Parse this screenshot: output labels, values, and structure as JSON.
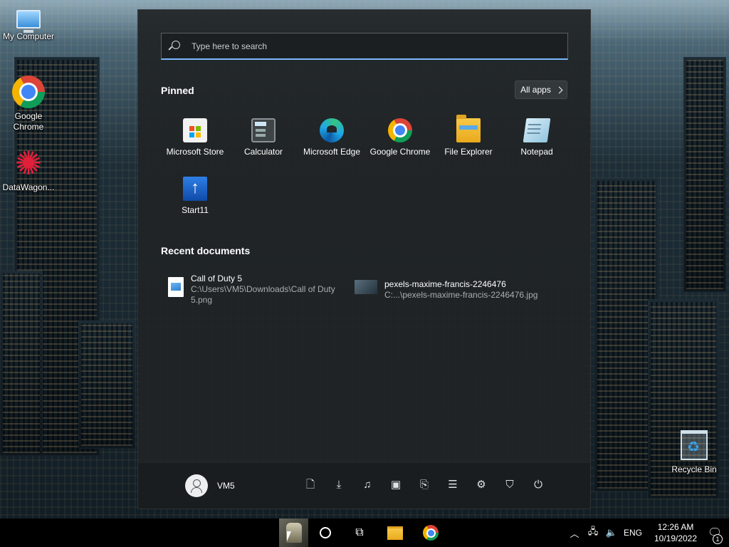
{
  "desktop": {
    "icons": [
      {
        "label": "My Computer"
      },
      {
        "label": "Google Chrome"
      },
      {
        "label": "DataWagon..."
      },
      {
        "label": "Recycle Bin"
      }
    ]
  },
  "start_menu": {
    "search": {
      "placeholder": "Type here to search"
    },
    "pinned_title": "Pinned",
    "all_apps_label": "All apps",
    "pinned_apps": [
      {
        "label": "Microsoft Store",
        "icon": "store-icon"
      },
      {
        "label": "Calculator",
        "icon": "calculator-icon"
      },
      {
        "label": "Microsoft Edge",
        "icon": "edge-icon"
      },
      {
        "label": "Google Chrome",
        "icon": "chrome-icon"
      },
      {
        "label": "File Explorer",
        "icon": "folder-icon"
      },
      {
        "label": "Notepad",
        "icon": "notepad-icon"
      },
      {
        "label": "Start11",
        "icon": "start11-icon"
      }
    ],
    "recent_title": "Recent documents",
    "recent_docs": [
      {
        "name": "Call of Duty 5",
        "path_line1": "C:\\Users\\VM5\\Downloads\\Call of Duty",
        "path_line2": "5.png"
      },
      {
        "name": "pexels-maxime-francis-2246476",
        "path_line1": "C:...\\pexels-maxime-francis-2246476.jpg"
      }
    ],
    "user": {
      "name": "VM5"
    },
    "quick_icons": [
      "document-icon",
      "download-icon",
      "music-icon",
      "pictures-icon",
      "network-folder-icon",
      "settings-sliders-icon",
      "gear-icon",
      "security-icon",
      "power-icon"
    ]
  },
  "taskbar": {
    "tray": {
      "language": "ENG",
      "time": "12:26 AM",
      "date": "10/19/2022",
      "notification_count": "1"
    }
  }
}
